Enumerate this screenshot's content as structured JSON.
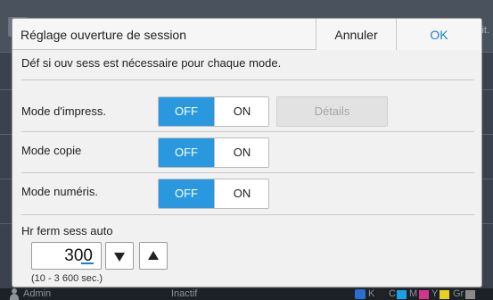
{
  "dialog": {
    "title": "Réglage ouverture de session",
    "cancel_label": "Annuler",
    "ok_label": "OK",
    "description": "Déf si ouv sess est nécessaire pour chaque mode."
  },
  "modes": [
    {
      "label": "Mode d'impress.",
      "off_label": "OFF",
      "on_label": "ON",
      "selected": "OFF"
    },
    {
      "label": "Mode copie",
      "off_label": "OFF",
      "on_label": "ON",
      "selected": "OFF"
    },
    {
      "label": "Mode numéris.",
      "off_label": "OFF",
      "on_label": "ON",
      "selected": "OFF"
    }
  ],
  "details_label": "Détails",
  "auto_logout": {
    "label": "Hr ferm sess auto",
    "value": "300",
    "range": "(10 - 3 600 sec.)"
  },
  "background": {
    "corner_text": "it.",
    "status_user": "Admin",
    "status_state": "Inactif",
    "toner": [
      {
        "label": "K",
        "color": "#222222"
      },
      {
        "label": "C",
        "color": "#1aa0e6"
      },
      {
        "label": "M",
        "color": "#d6338a"
      },
      {
        "label": "Y",
        "color": "#e8d21e"
      },
      {
        "label": "Gr",
        "color": "#8a8a8a"
      }
    ]
  },
  "colors": {
    "accent": "#2a98de",
    "ok_text": "#1a7fc9"
  }
}
